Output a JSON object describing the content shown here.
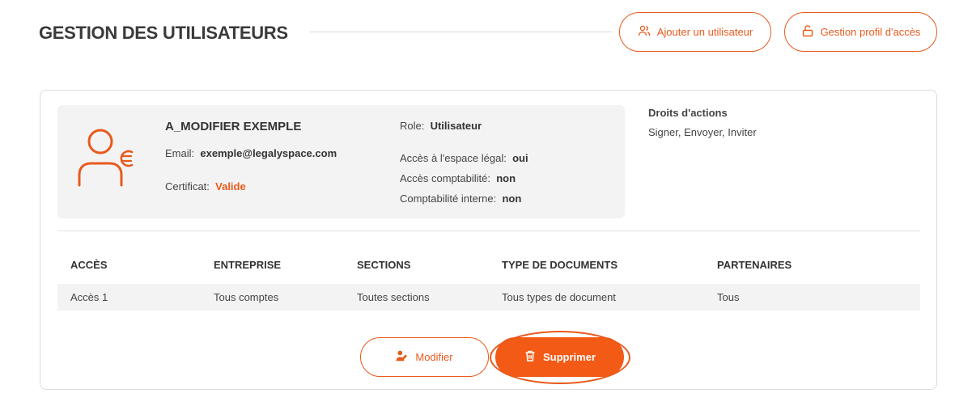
{
  "header": {
    "title": "GESTION DES UTILISATEURS",
    "add_user_label": "Ajouter un utilisateur",
    "access_profile_label": "Gestion profil d'accès"
  },
  "user": {
    "name": "A_MODIFIER EXEMPLE",
    "email_label": "Email:",
    "email": "exemple@legalyspace.com",
    "certificate_label": "Certificat:",
    "certificate": "Valide",
    "role_label": "Role:",
    "role": "Utilisateur",
    "legal_label": "Accès à l'espace légal:",
    "legal": "oui",
    "compta_label": "Accès comptabilité:",
    "compta": "non",
    "interne_label": "Comptabilité interne:",
    "interne": "non"
  },
  "rights": {
    "title": "Droits d'actions",
    "value": "Signer, Envoyer, Inviter"
  },
  "table": {
    "headers": [
      "ACCÈS",
      "ENTREPRISE",
      "SECTIONS",
      "TYPE DE DOCUMENTS",
      "PARTENAIRES"
    ],
    "rows": [
      [
        "Accès 1",
        "Tous comptes",
        "Toutes sections",
        "Tous types de document",
        "Tous"
      ]
    ]
  },
  "actions": {
    "edit_label": "Modifier",
    "delete_label": "Supprimer"
  },
  "colors": {
    "accent": "#e85a1d",
    "delete_bg": "#f25a16",
    "panel_bg": "#f3f3f3"
  },
  "icons": {
    "add_user": "users-icon",
    "access_profile": "unlock-icon",
    "avatar": "user-euro-icon",
    "edit": "user-edit-icon",
    "delete": "trash-icon"
  }
}
